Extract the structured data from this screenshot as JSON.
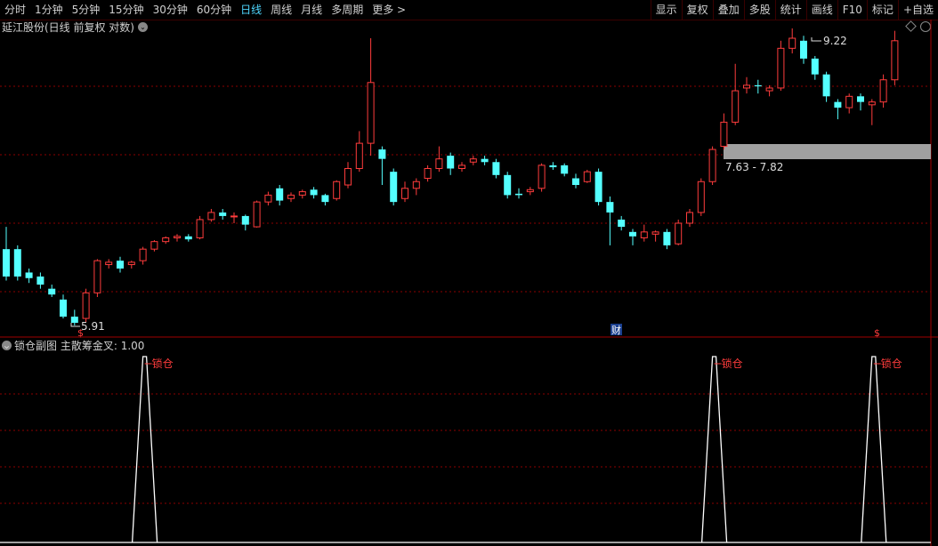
{
  "toolbar": {
    "tabs": [
      "分时",
      "1分钟",
      "5分钟",
      "15分钟",
      "30分钟",
      "60分钟",
      "日线",
      "周线",
      "月线",
      "多周期",
      "更多 >"
    ],
    "active_tab": "日线",
    "right_buttons": [
      "显示",
      "复权",
      "叠加",
      "多股",
      "统计",
      "画线",
      "F10",
      "标记",
      "+自选"
    ]
  },
  "main_panel": {
    "title": "延江股份(日线 前复权 对数)",
    "high_label": "9.22",
    "low_label": "5.91",
    "zone_label": "7.63 - 7.82",
    "marker_cai": "财",
    "marker_s": "$"
  },
  "sub_panel": {
    "title": "锁仓副图",
    "indicator": "主散筹金叉: 1.00",
    "signal_label": "锁仓"
  },
  "colors": {
    "up": "#ff3c3c",
    "down": "#54ffff",
    "grid": "#8b0000",
    "zone": "#a0a0a0"
  },
  "chart_data": {
    "type": "candlestick",
    "price_log_scale": true,
    "price_range": [
      5.6,
      10.0
    ],
    "candles": [
      [
        6.55,
        6.2,
        6.85,
        6.15
      ],
      [
        6.55,
        6.2,
        6.6,
        6.15
      ],
      [
        6.25,
        6.18,
        6.3,
        6.12
      ],
      [
        6.2,
        6.1,
        6.25,
        6.05
      ],
      [
        6.05,
        5.98,
        6.1,
        5.95
      ],
      [
        5.92,
        5.72,
        5.98,
        5.7
      ],
      [
        5.72,
        5.65,
        5.8,
        5.62
      ],
      [
        5.7,
        6.0,
        6.05,
        5.66
      ],
      [
        6.0,
        6.4,
        6.42,
        5.95
      ],
      [
        6.35,
        6.38,
        6.42,
        6.3
      ],
      [
        6.4,
        6.3,
        6.45,
        6.25
      ],
      [
        6.35,
        6.38,
        6.4,
        6.3
      ],
      [
        6.4,
        6.55,
        6.58,
        6.35
      ],
      [
        6.55,
        6.65,
        6.67,
        6.52
      ],
      [
        6.65,
        6.7,
        6.72,
        6.62
      ],
      [
        6.7,
        6.72,
        6.75,
        6.65
      ],
      [
        6.72,
        6.68,
        6.75,
        6.65
      ],
      [
        6.7,
        6.95,
        7.0,
        6.68
      ],
      [
        6.95,
        7.05,
        7.1,
        6.92
      ],
      [
        7.05,
        7.0,
        7.1,
        6.95
      ],
      [
        7.0,
        7.0,
        7.05,
        6.9
      ],
      [
        7.0,
        6.88,
        7.02,
        6.8
      ],
      [
        6.85,
        7.2,
        7.22,
        6.84
      ],
      [
        7.2,
        7.3,
        7.35,
        7.15
      ],
      [
        7.4,
        7.22,
        7.45,
        7.15
      ],
      [
        7.25,
        7.3,
        7.34,
        7.2
      ],
      [
        7.3,
        7.35,
        7.38,
        7.25
      ],
      [
        7.38,
        7.3,
        7.42,
        7.25
      ],
      [
        7.3,
        7.2,
        7.32,
        7.15
      ],
      [
        7.25,
        7.5,
        7.52,
        7.22
      ],
      [
        7.45,
        7.7,
        7.8,
        7.4
      ],
      [
        7.7,
        8.1,
        8.3,
        7.65
      ],
      [
        8.1,
        9.15,
        10.0,
        7.9
      ],
      [
        8.0,
        7.85,
        8.05,
        7.45
      ],
      [
        7.65,
        7.2,
        7.7,
        7.15
      ],
      [
        7.25,
        7.4,
        7.5,
        7.2
      ],
      [
        7.4,
        7.5,
        7.55,
        7.3
      ],
      [
        7.55,
        7.7,
        7.75,
        7.5
      ],
      [
        7.7,
        7.85,
        8.05,
        7.65
      ],
      [
        7.9,
        7.7,
        7.95,
        7.6
      ],
      [
        7.7,
        7.75,
        7.8,
        7.65
      ],
      [
        7.8,
        7.85,
        7.9,
        7.75
      ],
      [
        7.85,
        7.8,
        7.9,
        7.75
      ],
      [
        7.8,
        7.6,
        7.85,
        7.55
      ],
      [
        7.6,
        7.3,
        7.65,
        7.25
      ],
      [
        7.32,
        7.3,
        7.4,
        7.25
      ],
      [
        7.35,
        7.38,
        7.42,
        7.3
      ],
      [
        7.4,
        7.75,
        7.78,
        7.35
      ],
      [
        7.75,
        7.72,
        7.8,
        7.68
      ],
      [
        7.75,
        7.62,
        7.78,
        7.58
      ],
      [
        7.55,
        7.45,
        7.62,
        7.4
      ],
      [
        7.5,
        7.65,
        7.68,
        7.48
      ],
      [
        7.65,
        7.2,
        7.7,
        7.15
      ],
      [
        7.2,
        7.05,
        7.28,
        6.6
      ],
      [
        6.95,
        6.85,
        7.0,
        6.8
      ],
      [
        6.78,
        6.72,
        6.82,
        6.6
      ],
      [
        6.7,
        6.78,
        6.88,
        6.65
      ],
      [
        6.75,
        6.78,
        6.8,
        6.65
      ],
      [
        6.78,
        6.6,
        6.82,
        6.55
      ],
      [
        6.62,
        6.9,
        6.95,
        6.6
      ],
      [
        6.9,
        7.05,
        7.1,
        6.85
      ],
      [
        7.05,
        7.5,
        7.55,
        7.0
      ],
      [
        7.5,
        8.0,
        8.05,
        7.45
      ],
      [
        8.05,
        8.45,
        8.6,
        8.0
      ],
      [
        8.45,
        9.0,
        9.5,
        8.4
      ],
      [
        9.05,
        9.1,
        9.25,
        8.95
      ],
      [
        9.1,
        9.08,
        9.2,
        8.95
      ],
      [
        9.0,
        9.05,
        9.1,
        8.9
      ],
      [
        9.05,
        9.8,
        9.95,
        9.0
      ],
      [
        9.8,
        10.0,
        10.2,
        9.7
      ],
      [
        9.95,
        9.6,
        10.05,
        9.5
      ],
      [
        9.6,
        9.3,
        9.65,
        9.2
      ],
      [
        9.3,
        8.9,
        9.35,
        8.8
      ],
      [
        8.8,
        8.7,
        8.85,
        8.5
      ],
      [
        8.7,
        8.9,
        8.95,
        8.6
      ],
      [
        8.9,
        8.8,
        8.95,
        8.65
      ],
      [
        8.75,
        8.8,
        8.85,
        8.4
      ],
      [
        8.8,
        9.2,
        9.3,
        8.7
      ],
      [
        9.2,
        9.95,
        10.15,
        9.1
      ]
    ],
    "subchart_signal_indices": [
      12,
      62,
      76
    ]
  }
}
